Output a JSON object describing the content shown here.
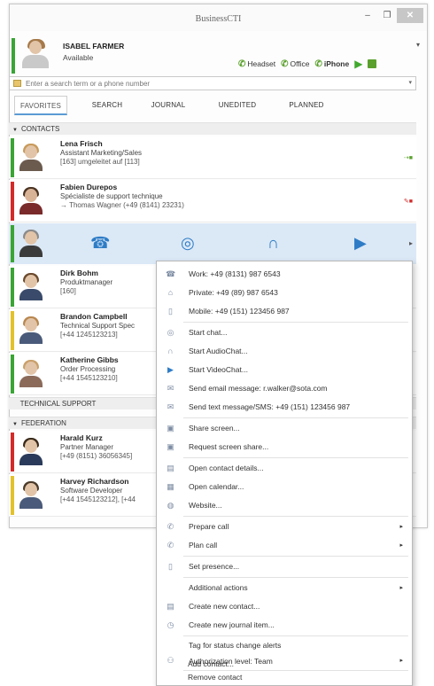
{
  "window": {
    "title": "BusinessCTI",
    "minimize": "–",
    "maximize": "❐",
    "close": "✕"
  },
  "user": {
    "name": "ISABEL FARMER",
    "status": "Available",
    "menu_caret": "▾",
    "devices": [
      {
        "label": "Headset",
        "icon": "phone-green-icon"
      },
      {
        "label": "Office",
        "icon": "phone-green-icon"
      },
      {
        "label": "iPhone",
        "icon": "phone-green-icon"
      }
    ],
    "play_icon": "▶",
    "presence_color": "#3aa535"
  },
  "search": {
    "placeholder": "Enter a search term or a phone number",
    "dropdown": "▾"
  },
  "tabs": [
    "FAVORITES",
    "SEARCH",
    "JOURNAL",
    "UNEDITED",
    "PLANNED"
  ],
  "sections": {
    "contacts": "CONTACTS",
    "technical_support": "TECHNICAL SUPPORT",
    "federation": "FEDERATION",
    "expanded_arrow": "▼"
  },
  "contacts": [
    {
      "name": "Lena Frisch",
      "line2": "Assistant Marketing/Sales",
      "line3": "[163] umgeleitet auf [113]",
      "presence_color": "#3aa535",
      "right_icon": "forward-icon"
    },
    {
      "name": "Fabien Durepos",
      "line2": "Spécialiste de support technique",
      "line3": "→ Thomas Wagner (+49 (8141) 23231)",
      "presence_color": "#d42a2a",
      "right_icon": "busy-icon"
    },
    {
      "name": "Dirk Bohm",
      "line2": "Produktmanager",
      "line3": "[160]",
      "presence_color": "#3aa535",
      "right_icon": "calendar-icon"
    },
    {
      "name": "Brandon Campbell",
      "line2": "Technical Support Spec",
      "line3": "[+44 1245123213]",
      "presence_color": "#e3c12b",
      "right_icon": "calendar-icon"
    },
    {
      "name": "Katherine Gibbs",
      "line2": "Order Processing",
      "line3": "[+44 1545123210]",
      "presence_color": "#3aa535",
      "right_icon": "calendar-icon"
    },
    {
      "name": "Harald Kurz",
      "line2": "Partner Manager",
      "line3": "[+49 (8151) 36056345]",
      "presence_color": "#d42a2a",
      "right_icon": "federation-icon"
    },
    {
      "name": "Harvey Richardson",
      "line2": "Software Developer",
      "line3": "[+44 1545123212], [+44",
      "presence_color": "#e3c12b",
      "right_icon": "federation-icon"
    }
  ],
  "hover_actions": [
    "call-contact-icon",
    "chat-icon",
    "audio-chat-icon",
    "video-chat-icon"
  ],
  "hover_more": "▸",
  "context_menu": [
    {
      "label": "Work: +49 (8131) 987 6543",
      "icon": "work-phone-icon"
    },
    {
      "label": "Private: +49 (89) 987 6543",
      "icon": "home-icon"
    },
    {
      "label": "Mobile: +49 (151) 123456 987",
      "icon": "mobile-icon"
    },
    {
      "label": "Start chat...",
      "icon": "chat-icon"
    },
    {
      "label": "Start AudioChat...",
      "icon": "audio-chat-icon"
    },
    {
      "label": "Start VideoChat...",
      "icon": "video-chat-icon"
    },
    {
      "label": "Send email message: r.walker@sota.com",
      "icon": "email-icon"
    },
    {
      "label": "Send text message/SMS: +49 (151) 123456 987",
      "icon": "sms-icon"
    },
    {
      "label": "Share screen...",
      "icon": "share-screen-icon"
    },
    {
      "label": "Request screen share...",
      "icon": "request-screen-icon"
    },
    {
      "label": "Open contact details...",
      "icon": "contact-details-icon"
    },
    {
      "label": "Open calendar...",
      "icon": "calendar-icon"
    },
    {
      "label": "Website...",
      "icon": "globe-icon"
    },
    {
      "label": "Prepare call",
      "icon": "prepare-call-icon",
      "submenu": "▸"
    },
    {
      "label": "Plan call",
      "icon": "plan-call-icon",
      "submenu": "▸"
    },
    {
      "label": "Set presence...",
      "icon": "presence-icon"
    },
    {
      "label": "Additional actions",
      "icon": "",
      "submenu": "▸"
    },
    {
      "label": "Create new contact...",
      "icon": "new-contact-icon"
    },
    {
      "label": "Create new journal item...",
      "icon": "journal-icon"
    },
    {
      "label": "Tag for status change alerts",
      "icon": ""
    },
    {
      "label": "Authorization level: Team",
      "icon": "authorization-icon",
      "submenu": "▸"
    },
    {
      "label": "Add contact...",
      "icon": ""
    },
    {
      "label": "Remove contact",
      "icon": ""
    }
  ]
}
